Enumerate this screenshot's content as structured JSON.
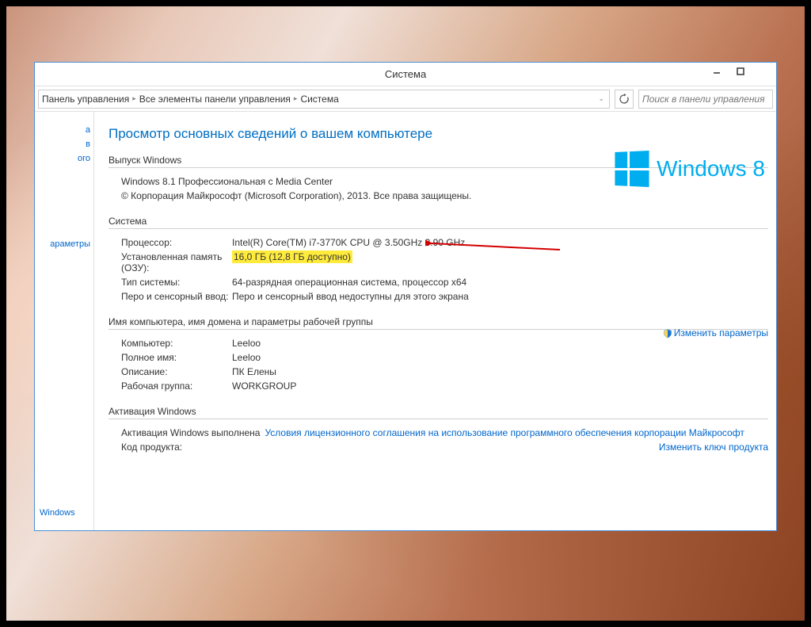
{
  "window": {
    "title": "Система",
    "search_placeholder": "Поиск в панели управления"
  },
  "breadcrumb": {
    "items": [
      "Панель управления",
      "Все элементы панели управления",
      "Система"
    ]
  },
  "sidebar": {
    "items": [
      "а",
      "в",
      "ого"
    ],
    "mid_item": "араметры",
    "bottom_item": "Windows"
  },
  "page": {
    "title": "Просмотр основных сведений о вашем компьютере"
  },
  "edition": {
    "header": "Выпуск Windows",
    "name": "Windows 8.1 Профессиональная с Media Center",
    "copyright": "© Корпорация Майкрософт (Microsoft Corporation), 2013. Все права защищены."
  },
  "logo": {
    "text": "Windows 8"
  },
  "system": {
    "header": "Система",
    "rows": {
      "cpu_label": "Процессор:",
      "cpu_value": "Intel(R) Core(TM) i7-3770K CPU @ 3.50GHz   3.90 GHz",
      "ram_label": "Установленная память (ОЗУ):",
      "ram_value": "16,0 ГБ (12,8 ГБ доступно)",
      "type_label": "Тип системы:",
      "type_value": "64-разрядная операционная система, процессор x64",
      "pen_label": "Перо и сенсорный ввод:",
      "pen_value": "Перо и сенсорный ввод недоступны для этого экрана"
    }
  },
  "computer": {
    "header": "Имя компьютера, имя домена и параметры рабочей группы",
    "rows": {
      "name_label": "Компьютер:",
      "name_value": "Leeloo",
      "full_label": "Полное имя:",
      "full_value": "Leeloo",
      "desc_label": "Описание:",
      "desc_value": "ПК Елены",
      "wg_label": "Рабочая группа:",
      "wg_value": "WORKGROUP"
    },
    "change_link": "Изменить параметры"
  },
  "activation": {
    "header": "Активация Windows",
    "status": "Активация Windows выполнена",
    "license_link": "Условия лицензионного соглашения на использование программного обеспечения корпорации Майкрософт",
    "key_label": "Код продукта:",
    "key_link": "Изменить ключ продукта"
  }
}
